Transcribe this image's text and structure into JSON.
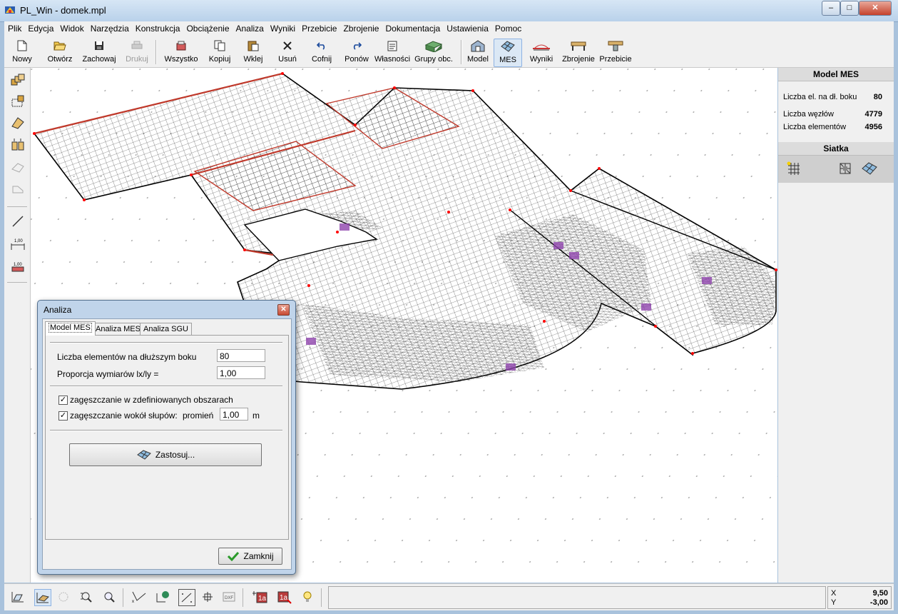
{
  "window": {
    "title": "PL_Win - domek.mpl",
    "min_label": "–",
    "max_label": "□",
    "close_label": "✕"
  },
  "menu": [
    "Plik",
    "Edycja",
    "Widok",
    "Narzędzia",
    "Konstrukcja",
    "Obciążenie",
    "Analiza",
    "Wyniki",
    "Przebicie",
    "Zbrojenie",
    "Dokumentacja",
    "Ustawienia",
    "Pomoc"
  ],
  "toolbar": {
    "nowy": "Nowy",
    "otworz": "Otwórz",
    "zachowaj": "Zachowaj",
    "drukuj": "Drukuj",
    "wszystko": "Wszystko",
    "kopiuj": "Kopiuj",
    "wklej": "Wklej",
    "usun": "Usuń",
    "cofnij": "Cofnij",
    "ponow": "Ponów",
    "wlasnosci": "Własności",
    "grupy": "Grupy obc.",
    "model": "Model",
    "mes": "MES",
    "wyniki": "Wyniki",
    "zbrojenie": "Zbrojenie",
    "przebicie": "Przebicie"
  },
  "right_panel": {
    "header": "Model MES",
    "rows": [
      {
        "label": "Liczba el. na dł. boku",
        "value": "80"
      },
      {
        "label": "Liczba węzłów",
        "value": "4779"
      },
      {
        "label": "Liczba elementów",
        "value": "4956"
      }
    ],
    "siatka_header": "Siatka"
  },
  "status": {
    "x_label": "X",
    "x_value": "9,50",
    "y_label": "Y",
    "y_value": "-3,00"
  },
  "dialog": {
    "title": "Analiza",
    "tabs": [
      "Model MES",
      "Analiza MES",
      "Analiza SGU"
    ],
    "elements_label": "Liczba elementów na dłuższym boku",
    "elements_value": "80",
    "ratio_label": "Proporcja wymiarów  lx/ly =",
    "ratio_value": "1,00",
    "densify_areas_label": "zagęszczanie w zdefiniowanych obszarach",
    "densify_areas_checked": true,
    "densify_columns_label": "zagęszczanie wokół słupów:",
    "densify_columns_checked": true,
    "radius_label": "promień",
    "radius_value": "1,00",
    "radius_unit": "m",
    "apply_label": "Zastosuj...",
    "close_label": "Zamknij"
  },
  "icons": {
    "new": "new-file-icon",
    "open": "open-folder-icon",
    "save": "save-icon",
    "print": "print-icon",
    "select_all": "select-all-icon",
    "copy": "copy-icon",
    "paste": "paste-icon",
    "delete": "delete-icon",
    "undo": "undo-icon",
    "redo": "redo-icon",
    "properties": "properties-icon",
    "load_groups": "load-groups-icon",
    "model": "model-icon",
    "mes": "mesh-icon",
    "results": "results-icon",
    "reinforcement": "reinforcement-icon",
    "punching": "punching-icon"
  },
  "colors": {
    "accent": "#8db2e3",
    "mesh_line": "#333333",
    "edge": "#000000",
    "beam": "#c0392b",
    "column": "#8e44ad",
    "node": "#ff0000"
  }
}
